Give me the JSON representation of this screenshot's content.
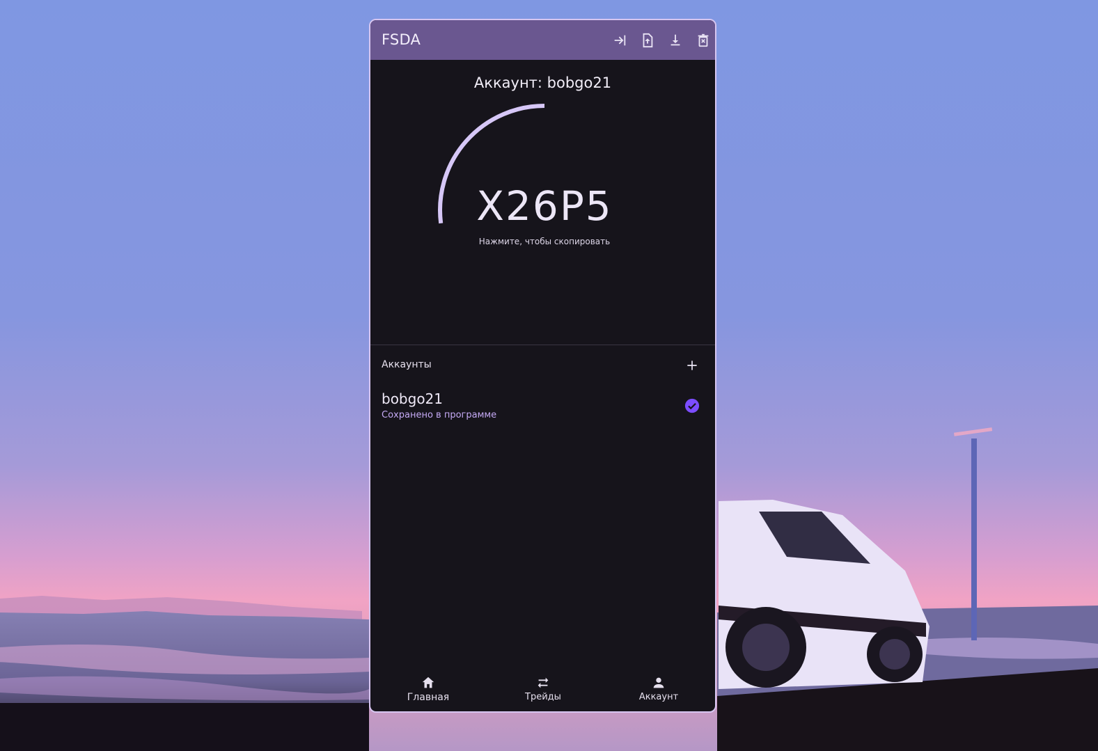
{
  "window": {
    "title": "FSDA",
    "toolbar": [
      {
        "icon": "login-icon"
      },
      {
        "icon": "file-upload-icon"
      },
      {
        "icon": "download-icon"
      },
      {
        "icon": "delete-icon"
      }
    ]
  },
  "main": {
    "account_heading": "Аккаунт: bobgo21",
    "code": "X26P5",
    "copy_hint": "Нажмите, чтобы скопировать",
    "timer_fraction_remaining": 0.27
  },
  "accounts": {
    "label": "Аккаунты",
    "add_icon": "plus-icon",
    "items": [
      {
        "name": "bobgo21",
        "subtitle": "Сохранено в программе",
        "selected": true
      }
    ]
  },
  "nav": {
    "items": [
      {
        "label": "Главная",
        "icon": "home-icon"
      },
      {
        "label": "Трейды",
        "icon": "swap-arrows-icon"
      },
      {
        "label": "Аккаунт",
        "icon": "person-icon"
      }
    ]
  },
  "colors": {
    "titlebar": "#6a5790",
    "window_bg": "#16141b",
    "window_border": "#d7c6f1",
    "accent": "#7c4dff",
    "ring": "#d6c7f7",
    "subtitle": "#c5aaf5"
  }
}
